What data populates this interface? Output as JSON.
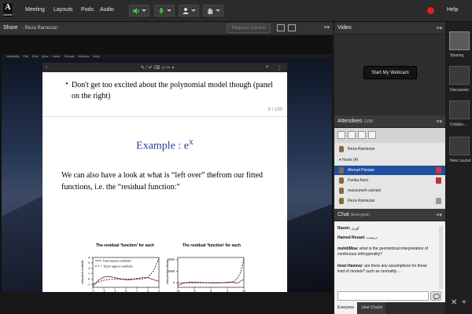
{
  "menubar": {
    "logo_text": "A",
    "logo_subtitle": "Adobe",
    "items": [
      "Meeting",
      "Layouts",
      "Pods",
      "Audio"
    ],
    "help": "Help"
  },
  "share_pod": {
    "title": "Share",
    "presenter": "- Reza Ramezan",
    "request_control": "Request Control",
    "mac_menu": [
      "Notability",
      "File",
      "Edit",
      "View",
      "Insert",
      "Format",
      "Window",
      "Help"
    ],
    "slide": {
      "bullet": "Don't get too excited about the polynomial model though (panel on the right)",
      "page_number": "9 / 100",
      "heading": "Example : e",
      "heading_sup": "x",
      "body": "We can also have a look at what is “left over” thefrom our fitted functions, i.e. the “residual function:”"
    }
  },
  "chart_data": [
    {
      "type": "line",
      "title": "The residual ‘function’ for each",
      "xlabel": "x",
      "ylabel": "estimated residuals",
      "xticks": [
        "-3",
        "-2",
        "-1",
        "0",
        "1",
        "2",
        "3"
      ],
      "yticks": [
        "-1",
        "0",
        "1",
        "2",
        "3",
        "4"
      ],
      "xlim": [
        -3,
        3
      ],
      "ylim": [
        -1.5,
        4
      ],
      "legend": "top-left",
      "series": [
        {
          "name": "least-squares residuals",
          "color": "#8b1a2b",
          "x": [
            -3,
            -2.5,
            -2,
            -1.5,
            -1,
            -0.5,
            0,
            0.5,
            1,
            1.5,
            2,
            2.5,
            3
          ],
          "y": [
            -1.4,
            -0.2,
            0.4,
            0.5,
            0.3,
            0.05,
            -0.1,
            -0.1,
            0.1,
            0.3,
            0.3,
            -0.1,
            -0.4
          ]
        },
        {
          "name": "Taylor approx residuals",
          "color": "#000000",
          "dashed": true,
          "x": [
            -3,
            -2.5,
            -2,
            -1.5,
            -1,
            -0.5,
            0,
            0.5,
            1,
            1.5,
            2,
            2.5,
            3
          ],
          "y": [
            -0.9,
            -0.5,
            -0.2,
            -0.05,
            0,
            0,
            0,
            0,
            0,
            0.02,
            0.3,
            1.5,
            3.8
          ]
        }
      ]
    },
    {
      "type": "line",
      "title": "The residual ‘function’ for each",
      "xlabel": "x",
      "ylabel": "estimated residuals",
      "xticks": [
        "-10",
        "-5",
        "0",
        "5",
        "10"
      ],
      "yticks": [
        "0",
        "10000",
        "20000"
      ],
      "xlim": [
        -10,
        10
      ],
      "ylim": [
        -4000,
        22000
      ],
      "series": [
        {
          "name": "least-squares residuals",
          "color": "#8b1a2b",
          "x": [
            -10,
            -8,
            -6,
            -4,
            -2,
            0,
            2,
            4,
            6,
            8,
            10
          ],
          "y": [
            -2500,
            -200,
            500,
            400,
            100,
            0,
            -100,
            200,
            600,
            -400,
            3000
          ]
        },
        {
          "name": "Taylor approx residuals",
          "color": "#000000",
          "dashed": true,
          "x": [
            -10,
            -8,
            -6,
            -4,
            -2,
            0,
            2,
            4,
            6,
            7,
            8,
            9,
            10
          ],
          "y": [
            0,
            0,
            0,
            0,
            0,
            0,
            0,
            0,
            200,
            1200,
            3500,
            9000,
            20500
          ]
        }
      ]
    }
  ],
  "video_pod": {
    "title": "Video",
    "start_webcam": "Start My Webcam"
  },
  "attendees_pod": {
    "title": "Attendees",
    "count": "(109)",
    "owner": "Reza Ramezan",
    "hosts_group": "Hosts (4)",
    "people": [
      "Ahmad Parsian",
      "Fariba Azizi",
      "masoumeh zamani",
      "Reza Ramezan"
    ]
  },
  "chat_pod": {
    "title": "Chat",
    "scope": "(Everyone)",
    "messages": [
      {
        "sender": "Razmi:",
        "text": "اورن"
      },
      {
        "sender": "Hamed Rezaei:",
        "text": "درست"
      },
      {
        "sender": "mehdiMoa:",
        "text": "what is the geometrical interpretation of continuous orthogonality?"
      },
      {
        "sender": "Iman Hamraz:",
        "text": "are there any assumptions for these kind of models? such as normality ..."
      }
    ],
    "tabs": [
      "Everyone",
      "Jalal Chachi"
    ]
  },
  "layouts_panel": {
    "items": [
      "Sharing",
      "Discussion",
      "Collabo...",
      "New Layout"
    ]
  },
  "colors": {
    "selected_row": "#1f4f9e",
    "accent_blue": "#2a3e9c",
    "record_red": "#e02020"
  }
}
